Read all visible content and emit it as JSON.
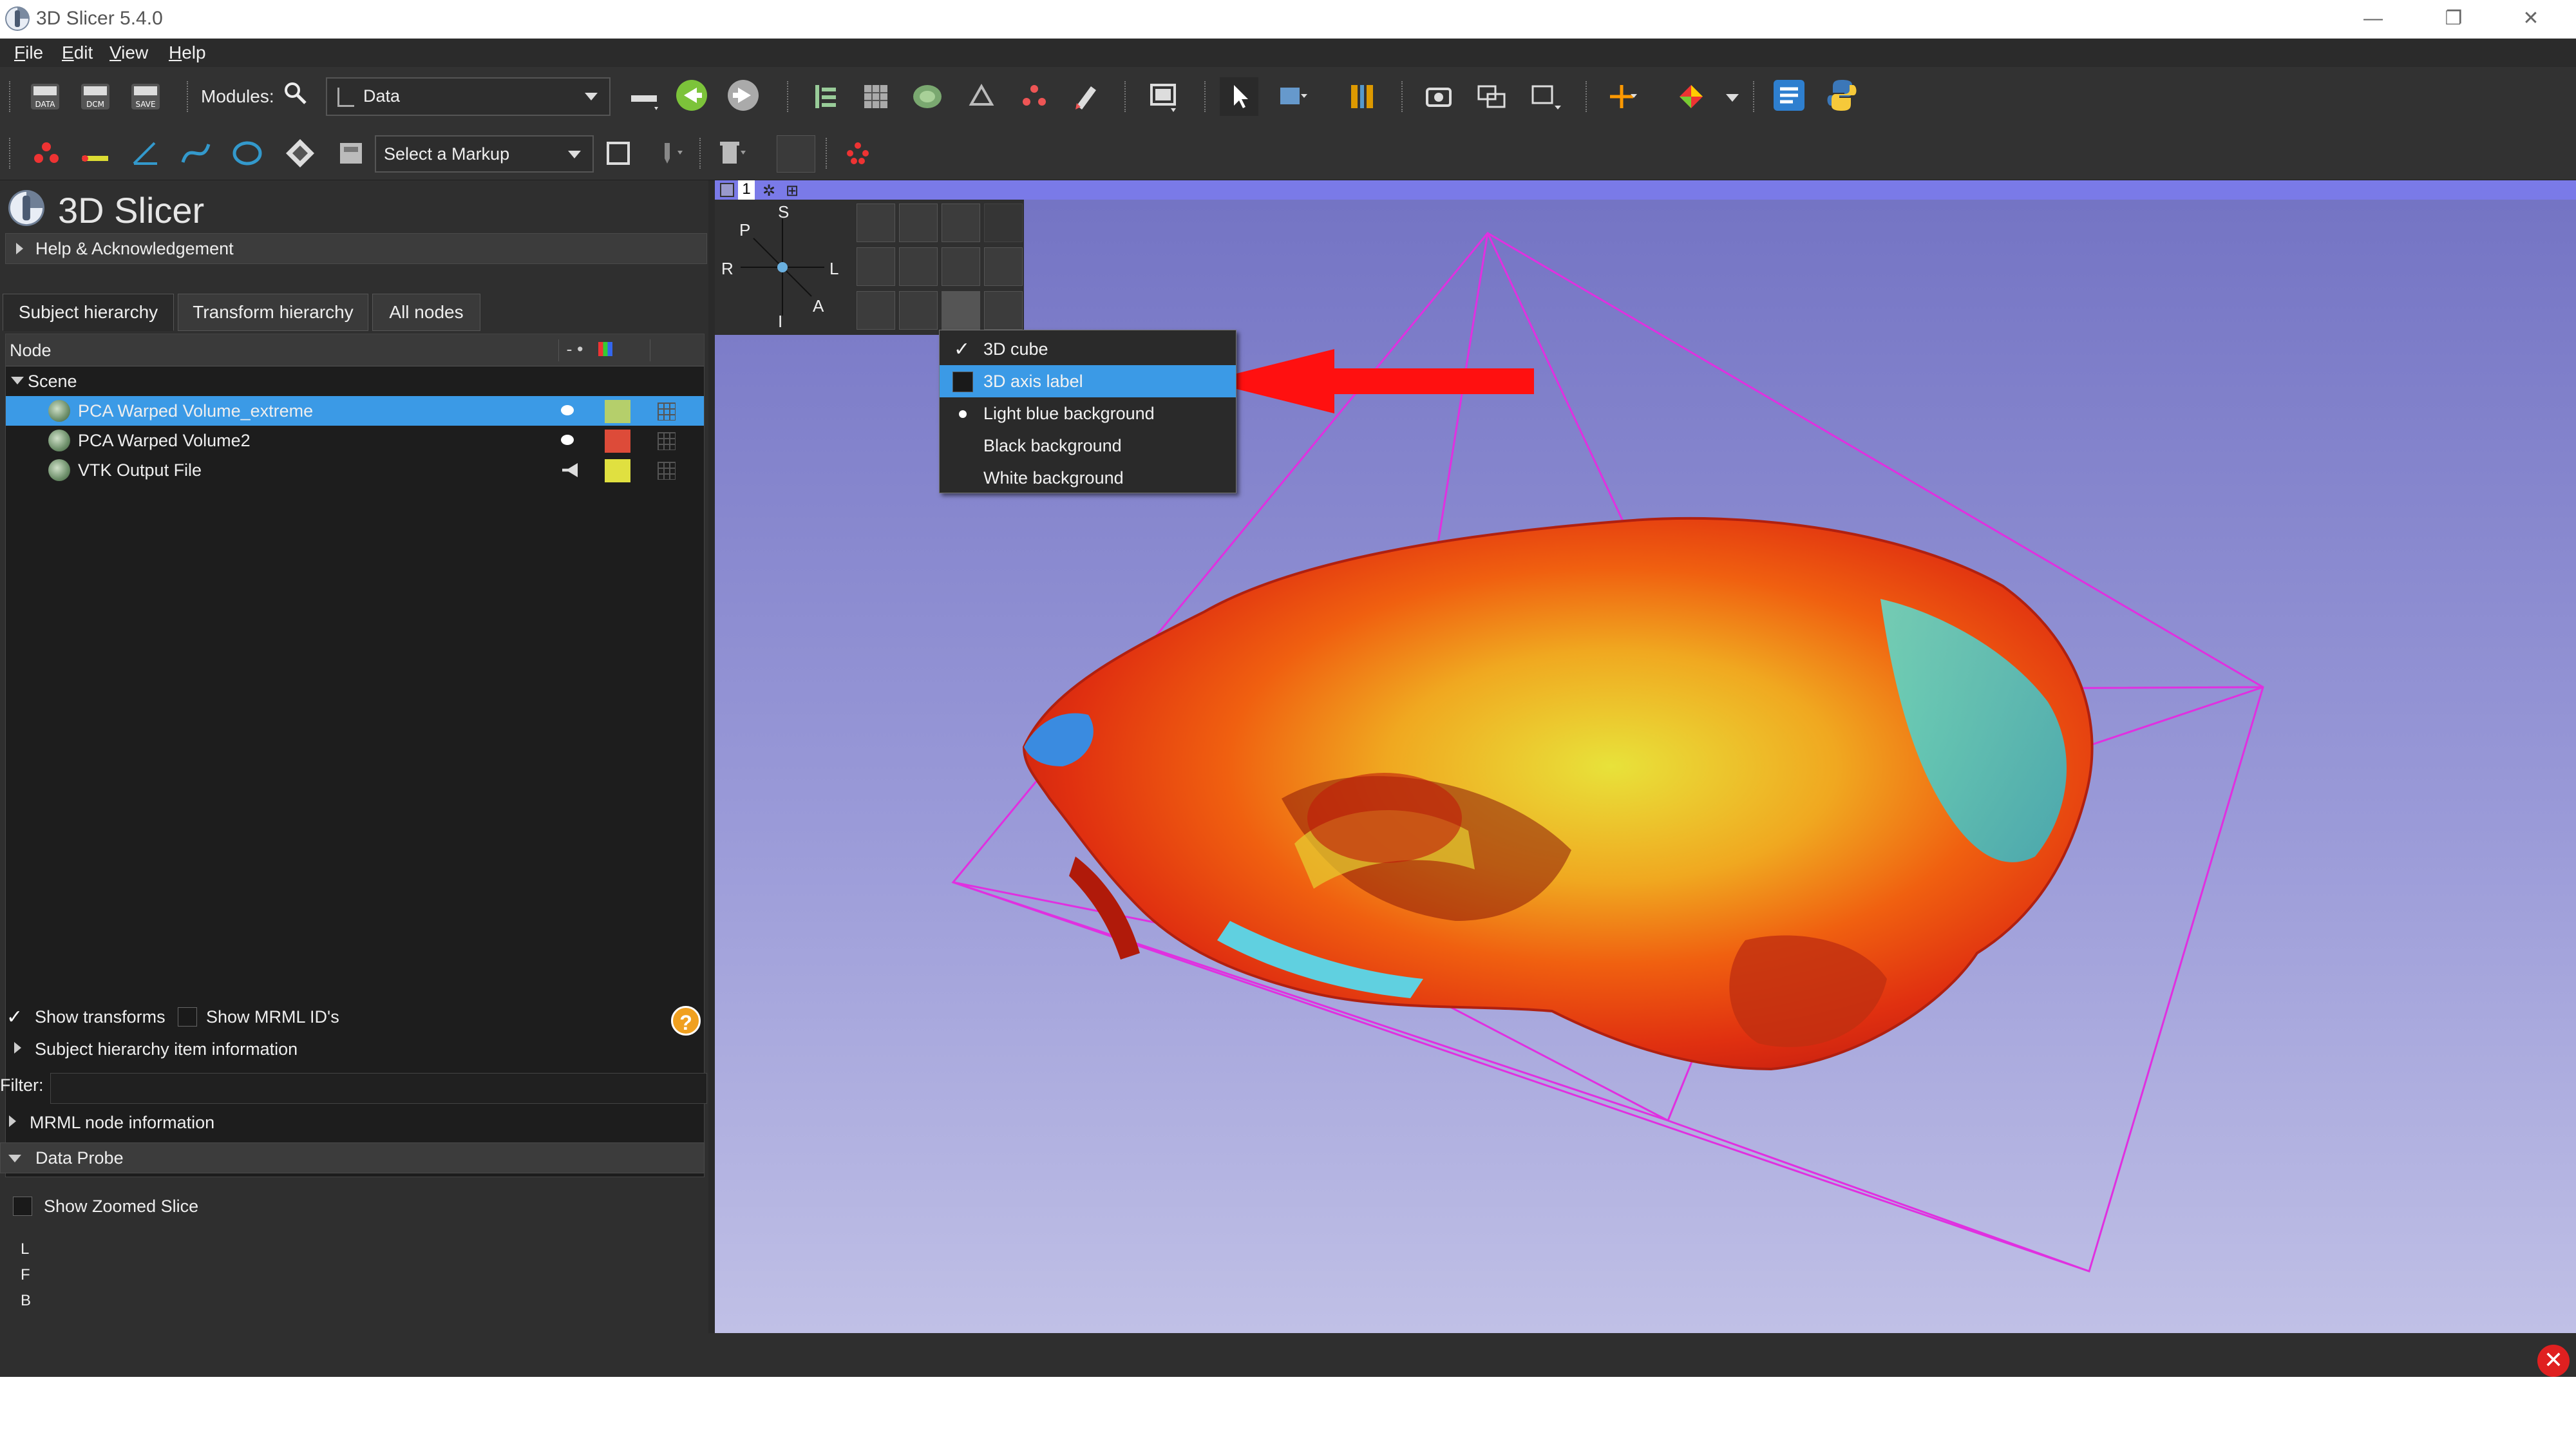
{
  "window": {
    "title": "3D Slicer 5.4.0",
    "controls": [
      "minimize-icon",
      "restore-icon",
      "close-icon"
    ]
  },
  "menubar": {
    "items": [
      {
        "label": "File",
        "underline": "F"
      },
      {
        "label": "Edit",
        "underline": "E"
      },
      {
        "label": "View",
        "underline": "V"
      },
      {
        "label": "Help",
        "underline": "H"
      }
    ]
  },
  "toolbar": {
    "data_icon_label": "DATA",
    "dcm_icon_label": "DCM",
    "save_icon_label": "SAVE",
    "modules_label": "Modules:",
    "module_selected": "Data",
    "markup_selector": "Select a Markup"
  },
  "app_header": {
    "title": "3D Slicer"
  },
  "help_section": {
    "label": "Help & Acknowledgement"
  },
  "tabs": [
    {
      "label": "Subject hierarchy",
      "active": true
    },
    {
      "label": "Transform hierarchy",
      "active": false
    },
    {
      "label": "All nodes",
      "active": false
    }
  ],
  "tree": {
    "column_node": "Node",
    "scene_label": "Scene",
    "rows": [
      {
        "name": "PCA Warped Volume_extreme",
        "selected": true,
        "color": "#b5cf6b",
        "visibility": "eye"
      },
      {
        "name": "PCA Warped Volume2",
        "selected": false,
        "color": "#dd4b39",
        "visibility": "eye"
      },
      {
        "name": "VTK Output File",
        "selected": false,
        "color": "#e0e040",
        "visibility": "eye-hidden"
      }
    ]
  },
  "options": {
    "show_transforms": "Show transforms",
    "show_transforms_checked": true,
    "show_mrml_ids": "Show MRML ID's",
    "show_mrml_ids_checked": false,
    "item_info": "Subject hierarchy item information",
    "filter_label": "Filter:",
    "filter_value": "",
    "mrml_info": "MRML node information",
    "data_probe": "Data Probe",
    "show_zoomed_slice": "Show Zoomed Slice",
    "probe_labels": [
      "L",
      "F",
      "B"
    ]
  },
  "view": {
    "tab_number": "1",
    "orientation": {
      "S": "S",
      "P": "P",
      "R": "R",
      "L": "L",
      "I": "I",
      "A": "A"
    },
    "background_top": "#7474c4",
    "background_bottom": "#c0c0e6",
    "bounding_box_color": "#e030e0"
  },
  "context_menu": {
    "items": [
      {
        "label": "3D cube",
        "state": "checked"
      },
      {
        "label": "3D axis label",
        "state": "unchecked",
        "highlighted": true
      },
      {
        "label": "Light blue background",
        "state": "radio-selected"
      },
      {
        "label": "Black background",
        "state": "none"
      },
      {
        "label": "White background",
        "state": "none"
      }
    ]
  },
  "annotation": {
    "arrow_color": "#ff1010",
    "points_to": "3D axis label"
  }
}
